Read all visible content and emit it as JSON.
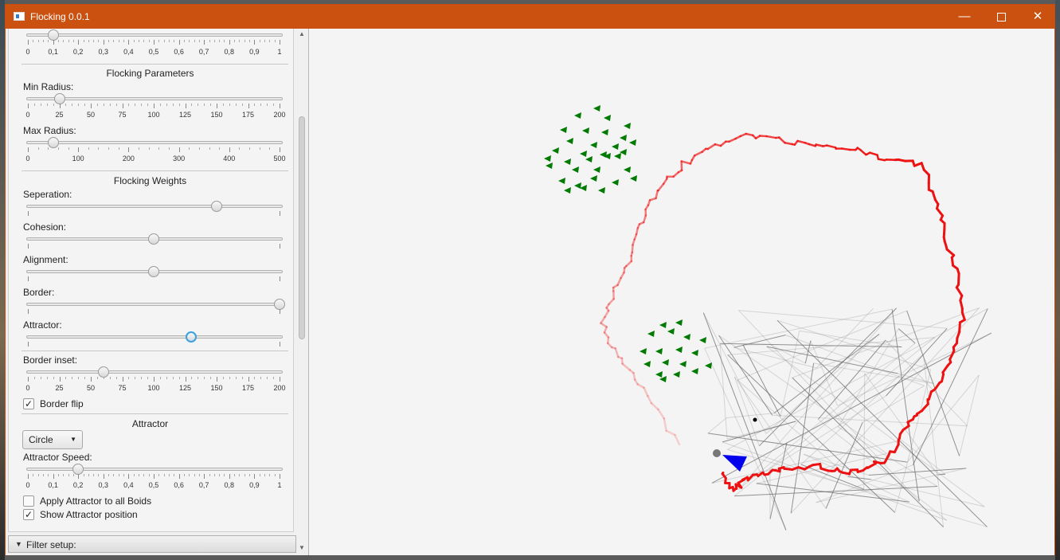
{
  "window": {
    "title": "Flocking 0.0.1",
    "minimize": "—",
    "close": "✕"
  },
  "panel": {
    "top_slider": {
      "value": 0.1,
      "ticks": [
        "0",
        "0,1",
        "0,2",
        "0,3",
        "0,4",
        "0,5",
        "0,6",
        "0,7",
        "0,8",
        "0,9",
        "1"
      ]
    },
    "flocking_parameters": {
      "title": "Flocking Parameters",
      "min_radius": {
        "label": "Min Radius:",
        "value": 25,
        "max": 200,
        "ticks": [
          "0",
          "25",
          "50",
          "75",
          "100",
          "125",
          "150",
          "175",
          "200"
        ]
      },
      "max_radius": {
        "label": "Max Radius:",
        "value": 50,
        "max": 500,
        "ticks": [
          "0",
          "100",
          "200",
          "300",
          "400",
          "500"
        ]
      }
    },
    "flocking_weights": {
      "title": "Flocking Weights",
      "separation": {
        "label": "Seperation:",
        "value": 0.75
      },
      "cohesion": {
        "label": "Cohesion:",
        "value": 0.5
      },
      "alignment": {
        "label": "Alignment:",
        "value": 0.5
      },
      "border": {
        "label": "Border:",
        "value": 1.0
      },
      "attractor": {
        "label": "Attractor:",
        "value": 0.65
      }
    },
    "border_inset": {
      "label": "Border inset:",
      "value": 60,
      "max": 200,
      "ticks": [
        "0",
        "25",
        "50",
        "75",
        "100",
        "125",
        "150",
        "175",
        "200"
      ]
    },
    "border_flip": {
      "label": "Border flip",
      "checked": true
    },
    "attractor": {
      "title": "Attractor",
      "mode": "Circle",
      "speed": {
        "label": "Attractor Speed:",
        "value": 0.2,
        "ticks": [
          "0",
          "0,1",
          "0,2",
          "0,3",
          "0,4",
          "0,5",
          "0,6",
          "0,7",
          "0,8",
          "0,9",
          "1"
        ]
      },
      "apply_all": {
        "label": "Apply Attractor to all Boids",
        "checked": false
      },
      "show_position": {
        "label": "Show Attractor position",
        "checked": true
      }
    },
    "filter_setup": "Filter setup:"
  },
  "colors": {
    "title_bar": "#ca5110",
    "boid": "#007a00",
    "leader": "#0000ee",
    "trail": "#ee1111"
  }
}
